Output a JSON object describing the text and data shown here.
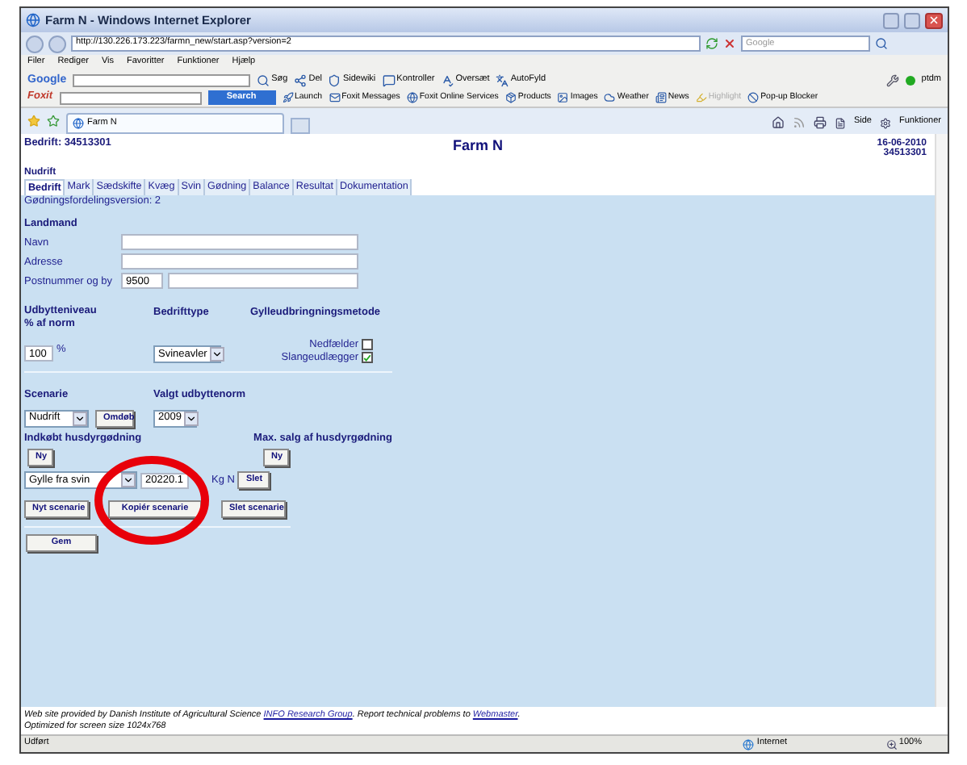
{
  "window": {
    "title": "Farm N - Windows Internet Explorer"
  },
  "address_bar": {
    "url": "http://130.226.173.223/farmn_new/start.asp?version=2",
    "search_placeholder": "Google"
  },
  "menu": [
    "Filer",
    "Rediger",
    "Vis",
    "Favoritter",
    "Funktioner",
    "Hjælp"
  ],
  "google_toolbar": {
    "logo": "Google",
    "items": [
      "Søg",
      "Del",
      "Sidewiki",
      "Kontroller",
      "Oversæt",
      "AutoFyld"
    ],
    "account": "ptdm"
  },
  "foxit_toolbar": {
    "logo": "Foxit",
    "search_button": "Search",
    "items": [
      {
        "label": "Launch",
        "disabled": false
      },
      {
        "label": "Foxit Messages",
        "disabled": false
      },
      {
        "label": "Foxit Online Services",
        "disabled": false
      },
      {
        "label": "Products",
        "disabled": false
      },
      {
        "label": "Images",
        "disabled": false
      },
      {
        "label": "Weather",
        "disabled": false
      },
      {
        "label": "News",
        "disabled": false
      },
      {
        "label": "Highlight",
        "disabled": true
      },
      {
        "label": "Pop-up Blocker",
        "disabled": false
      }
    ]
  },
  "browser_tab": {
    "title": "Farm N"
  },
  "command_bar": [
    "Side",
    "Funktioner"
  ],
  "page": {
    "header": {
      "company": "Bedrift: 34513301",
      "title": "Farm N",
      "date": "16-06-2010",
      "number": "34513301",
      "subtitle": "Nudrift"
    },
    "tabs": [
      {
        "label": "Bedrift",
        "selected": true
      },
      {
        "label": "Mark",
        "selected": false
      },
      {
        "label": "Sædskifte",
        "selected": false
      },
      {
        "label": "Kvæg",
        "selected": false
      },
      {
        "label": "Svin",
        "selected": false
      },
      {
        "label": "Gødning",
        "selected": false
      },
      {
        "label": "Balance",
        "selected": false
      },
      {
        "label": "Resultat",
        "selected": false
      },
      {
        "label": "Dokumentation",
        "selected": false
      }
    ],
    "version": "Gødningsfordelingsversion: 2",
    "landmand": {
      "heading": "Landmand",
      "name_label": "Navn",
      "address_label": "Adresse",
      "postal_label": "Postnummer og by",
      "postal_code": "9500"
    },
    "yield": {
      "heading_1": "Udbytteniveau",
      "heading_2": "% af norm",
      "value": "100",
      "unit": "%"
    },
    "farm_type": {
      "heading": "Bedrifttype",
      "value": "Svineavler"
    },
    "spreading": {
      "heading": "Gylleudbringningsmetode",
      "options": [
        {
          "label": "Nedfælder",
          "checked": false
        },
        {
          "label": "Slangeudlægger",
          "checked": true
        }
      ]
    },
    "scenario": {
      "heading": "Scenarie",
      "value": "Nudrift",
      "rename_button": "Omdøb"
    },
    "norm": {
      "heading": "Valgt udbyttenorm",
      "value": "2009"
    },
    "purchased": {
      "heading": "Indkøbt husdyrgødning",
      "new_button": "Ny",
      "type": "Gylle fra svin",
      "amount": "20220.1",
      "unit": "Kg N",
      "delete_button": "Slet"
    },
    "max_sale": {
      "heading": "Max. salg af husdyrgødning",
      "new_button": "Ny"
    },
    "scenario_buttons": [
      "Nyt scenarie",
      "Kopiér scenarie",
      "Slet scenarie"
    ],
    "save_button": "Gem"
  },
  "footer": {
    "before": "Web site provided by Danish Institute of Agricultural Science ",
    "link_1": "INFO Research Group",
    "middle": ". Report technical problems to ",
    "link_2": "Webmaster",
    "after": ".",
    "line_2": "Optimized for screen size 1024x768"
  },
  "status_bar": {
    "status": "Udført",
    "zone": "Internet",
    "zoom": "100%"
  }
}
